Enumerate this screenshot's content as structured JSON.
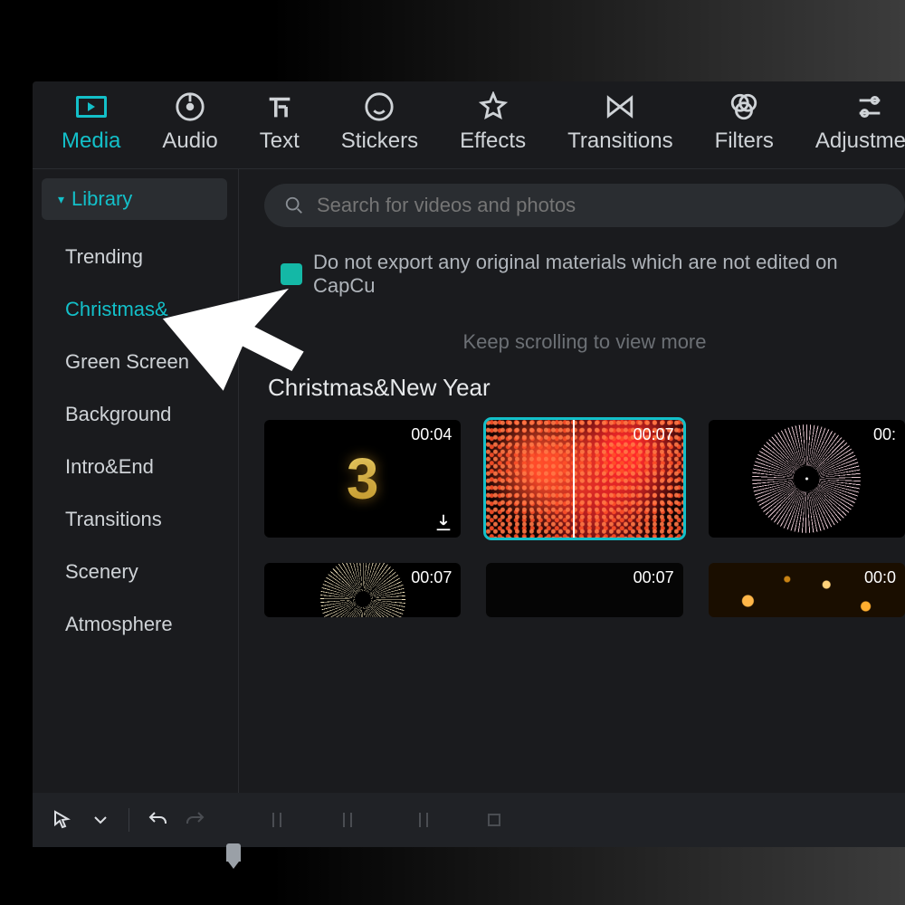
{
  "tabs": [
    {
      "id": "media",
      "label": "Media"
    },
    {
      "id": "audio",
      "label": "Audio"
    },
    {
      "id": "text",
      "label": "Text"
    },
    {
      "id": "stickers",
      "label": "Stickers"
    },
    {
      "id": "effects",
      "label": "Effects"
    },
    {
      "id": "transitions",
      "label": "Transitions"
    },
    {
      "id": "filters",
      "label": "Filters"
    },
    {
      "id": "adjustment",
      "label": "Adjustment"
    }
  ],
  "active_tab": "media",
  "sidebar": {
    "header": "Library",
    "items": [
      {
        "label": "Trending",
        "active": false
      },
      {
        "label": "Christmas&",
        "active": true
      },
      {
        "label": "Green Screen",
        "active": false
      },
      {
        "label": "Background",
        "active": false
      },
      {
        "label": "Intro&End",
        "active": false
      },
      {
        "label": "Transitions",
        "active": false
      },
      {
        "label": "Scenery",
        "active": false
      },
      {
        "label": "Atmosphere",
        "active": false
      }
    ]
  },
  "search": {
    "placeholder": "Search for videos and photos"
  },
  "export_note": "Do not export any original materials which are not edited on CapCu",
  "scroll_hint": "Keep scrolling to view more",
  "section_title": "Christmas&New Year",
  "clips_row1": [
    {
      "duration": "00:04",
      "downloadable": true,
      "selected": false,
      "kind": "countdown3"
    },
    {
      "duration": "00:07",
      "downloadable": false,
      "selected": true,
      "kind": "red-fireworks"
    },
    {
      "duration": "00:",
      "downloadable": false,
      "selected": false,
      "kind": "white-firework"
    }
  ],
  "clips_row2": [
    {
      "duration": "00:07",
      "kind": "white-firework"
    },
    {
      "duration": "00:07",
      "kind": "dark"
    },
    {
      "duration": "00:0",
      "kind": "bokeh"
    }
  ]
}
